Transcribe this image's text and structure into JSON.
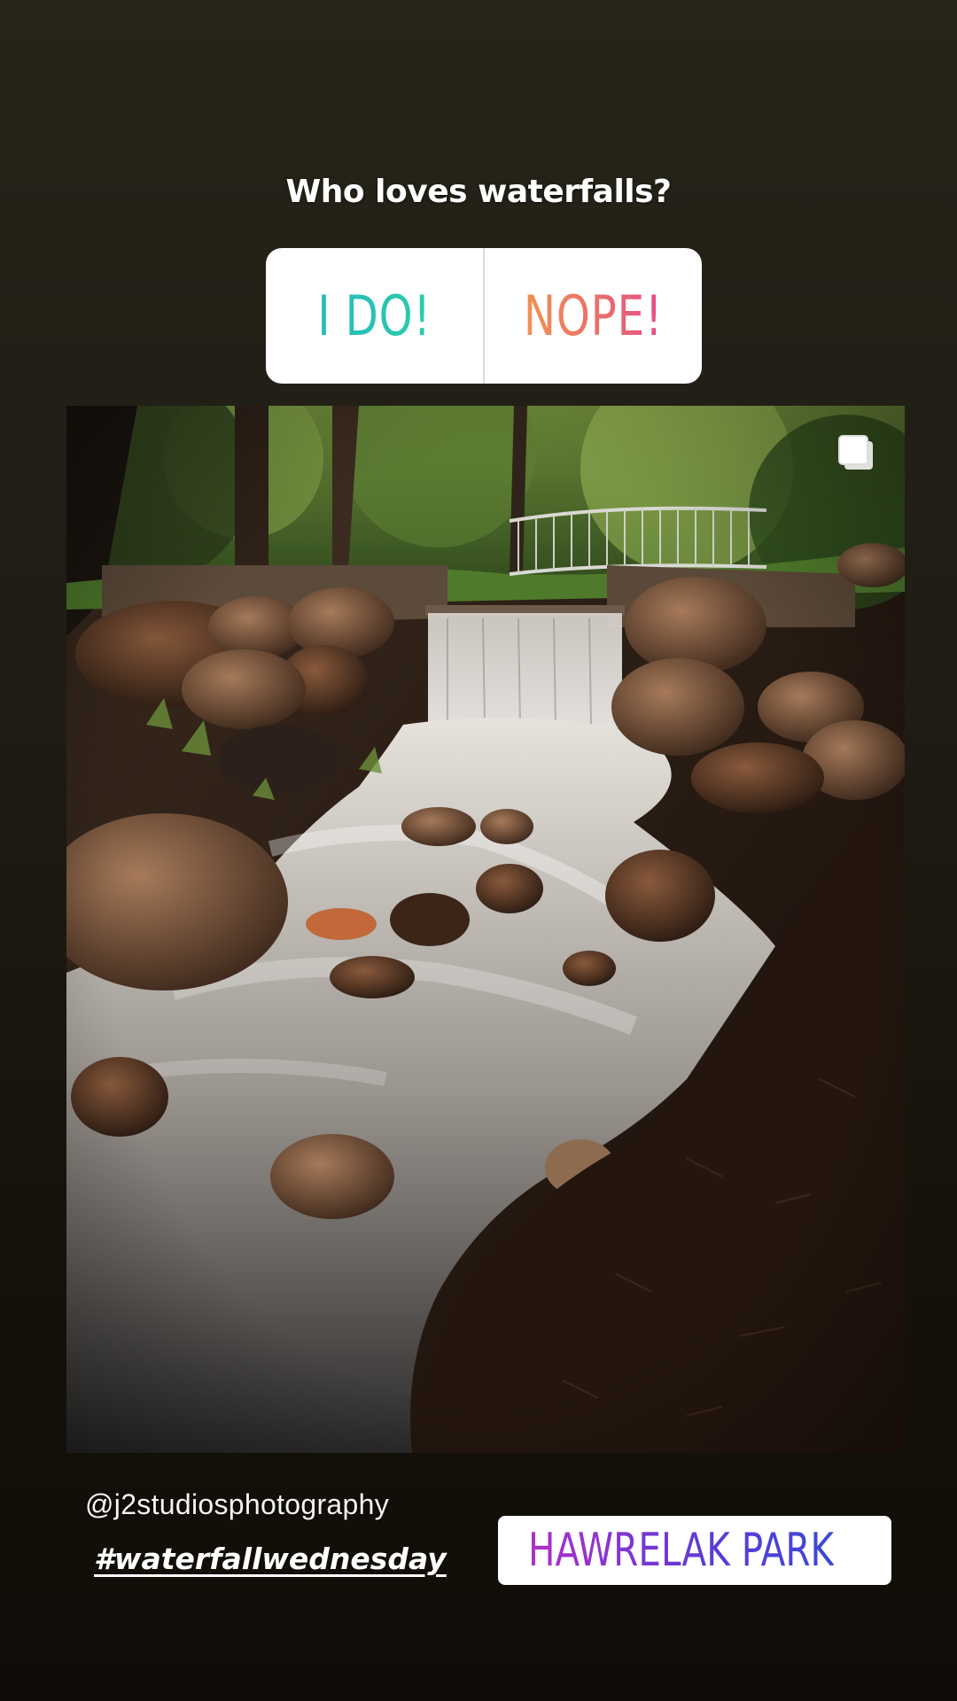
{
  "story": {
    "poll": {
      "question": "Who loves waterfalls?",
      "options": [
        {
          "label": "I DO!",
          "gradient": [
            "#23b5c8",
            "#2fd09f"
          ]
        },
        {
          "label": "NOPE!",
          "gradient": [
            "#f39a4a",
            "#e2478c"
          ]
        }
      ]
    },
    "photo": {
      "carousel_icon": "multiple-photos-icon"
    },
    "caption": {
      "handle": "@j2studiosphotography",
      "hashtag": "#waterfallwednesday"
    },
    "location": {
      "icon": "location-pin-icon",
      "label": "HAWRELAK PARK",
      "gradient": [
        "#b02fc7",
        "#3b48d6"
      ]
    }
  }
}
